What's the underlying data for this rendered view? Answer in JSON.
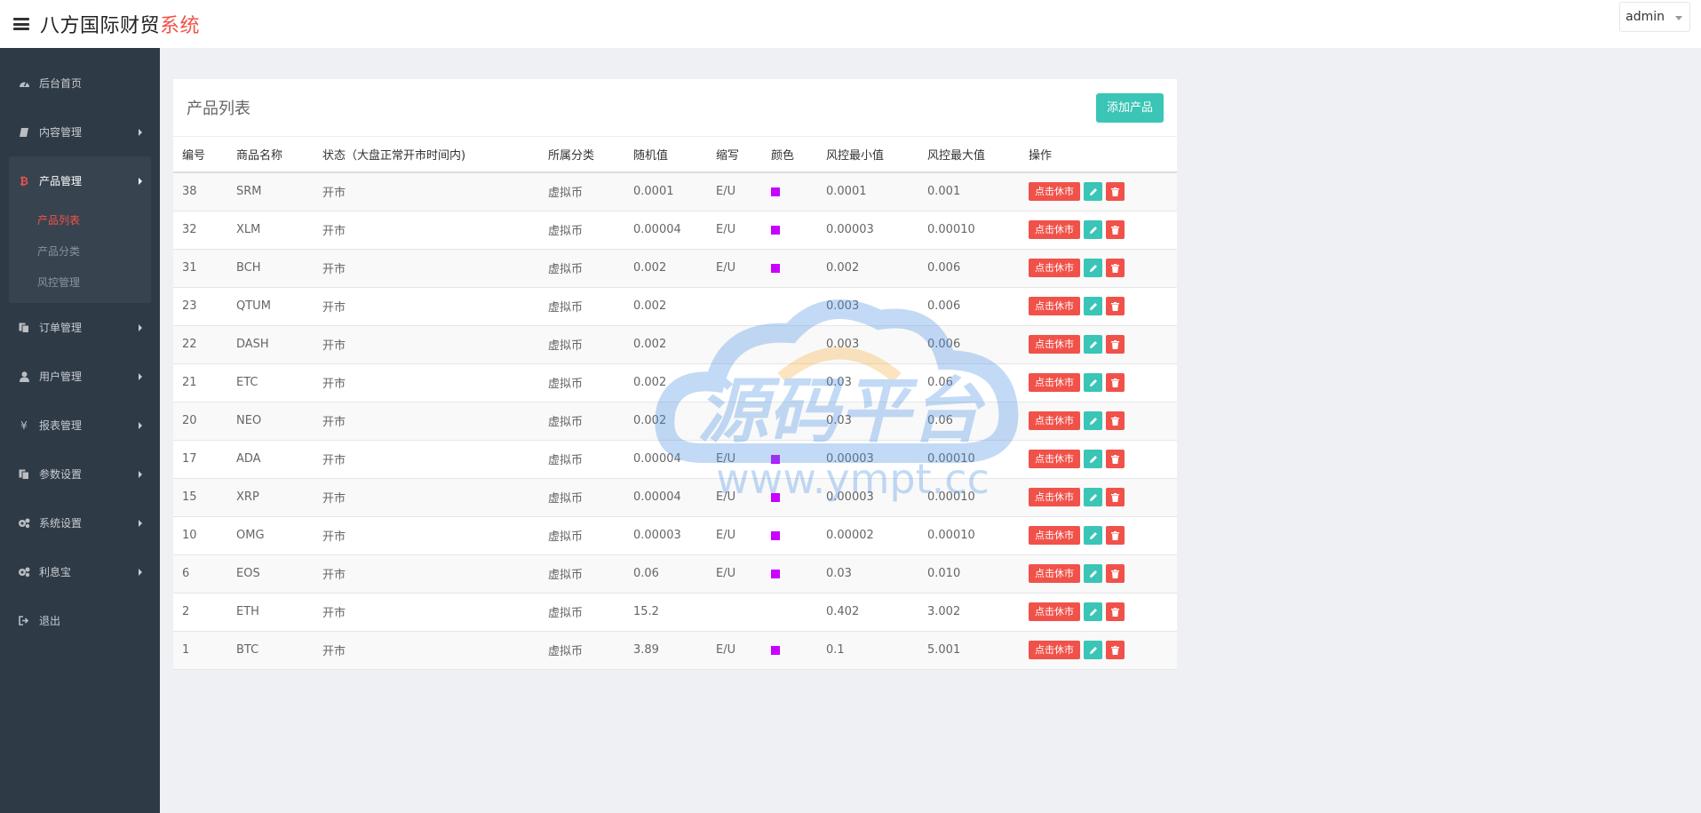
{
  "header": {
    "brand_main": "八方国际财贸",
    "brand_accent": "系统",
    "user": "admin"
  },
  "sidebar": {
    "items": [
      {
        "label": "后台首页",
        "icon": "dashboard-icon"
      },
      {
        "label": "内容管理",
        "icon": "book-icon"
      },
      {
        "label": "产品管理",
        "icon": "bitcoin-icon"
      },
      {
        "label": "订单管理",
        "icon": "copy-icon"
      },
      {
        "label": "用户管理",
        "icon": "user-icon"
      },
      {
        "label": "报表管理",
        "icon": "yen-icon"
      },
      {
        "label": "参数设置",
        "icon": "copy-icon"
      },
      {
        "label": "系统设置",
        "icon": "gears-icon"
      },
      {
        "label": "利息宝",
        "icon": "gears-icon"
      },
      {
        "label": "退出",
        "icon": "sign-out-icon"
      }
    ],
    "submenu": [
      {
        "label": "产品列表",
        "active": true
      },
      {
        "label": "产品分类",
        "active": false
      },
      {
        "label": "风控管理",
        "active": false
      }
    ]
  },
  "panel": {
    "title": "产品列表",
    "add_button": "添加产品"
  },
  "table": {
    "headers": [
      "编号",
      "商品名称",
      "状态（大盘正常开市时间内)",
      "所属分类",
      "随机值",
      "缩写",
      "颜色",
      "风控最小值",
      "风控最大值",
      "操作"
    ],
    "close_label": "点击休市",
    "rows": [
      {
        "id": "38",
        "name": "SRM",
        "status": "开市",
        "category": "虚拟币",
        "random": "0.0001",
        "abbr": "E/U",
        "color": true,
        "min": "0.0001",
        "max": "0.001"
      },
      {
        "id": "32",
        "name": "XLM",
        "status": "开市",
        "category": "虚拟币",
        "random": "0.00004",
        "abbr": "E/U",
        "color": true,
        "min": "0.00003",
        "max": "0.00010"
      },
      {
        "id": "31",
        "name": "BCH",
        "status": "开市",
        "category": "虚拟币",
        "random": "0.002",
        "abbr": "E/U",
        "color": true,
        "min": "0.002",
        "max": "0.006"
      },
      {
        "id": "23",
        "name": "QTUM",
        "status": "开市",
        "category": "虚拟币",
        "random": "0.002",
        "abbr": "",
        "color": false,
        "min": "0.003",
        "max": "0.006"
      },
      {
        "id": "22",
        "name": "DASH",
        "status": "开市",
        "category": "虚拟币",
        "random": "0.002",
        "abbr": "",
        "color": false,
        "min": "0.003",
        "max": "0.006"
      },
      {
        "id": "21",
        "name": "ETC",
        "status": "开市",
        "category": "虚拟币",
        "random": "0.002",
        "abbr": "",
        "color": false,
        "min": "0.03",
        "max": "0.06"
      },
      {
        "id": "20",
        "name": "NEO",
        "status": "开市",
        "category": "虚拟币",
        "random": "0.002",
        "abbr": "",
        "color": false,
        "min": "0.03",
        "max": "0.06"
      },
      {
        "id": "17",
        "name": "ADA",
        "status": "开市",
        "category": "虚拟币",
        "random": "0.00004",
        "abbr": "E/U",
        "color": true,
        "min": "0.00003",
        "max": "0.00010"
      },
      {
        "id": "15",
        "name": "XRP",
        "status": "开市",
        "category": "虚拟币",
        "random": "0.00004",
        "abbr": "E/U",
        "color": true,
        "min": "0.00003",
        "max": "0.00010"
      },
      {
        "id": "10",
        "name": "OMG",
        "status": "开市",
        "category": "虚拟币",
        "random": "0.00003",
        "abbr": "E/U",
        "color": true,
        "min": "0.00002",
        "max": "0.00010"
      },
      {
        "id": "6",
        "name": "EOS",
        "status": "开市",
        "category": "虚拟币",
        "random": "0.06",
        "abbr": "E/U",
        "color": true,
        "min": "0.03",
        "max": "0.010"
      },
      {
        "id": "2",
        "name": "ETH",
        "status": "开市",
        "category": "虚拟币",
        "random": "15.2",
        "abbr": "",
        "color": false,
        "min": "0.402",
        "max": "3.002"
      },
      {
        "id": "1",
        "name": "BTC",
        "status": "开市",
        "category": "虚拟币",
        "random": "3.89",
        "abbr": "E/U",
        "color": true,
        "min": "0.1",
        "max": "5.001"
      }
    ]
  },
  "colors": {
    "accent": "#f0524a",
    "teal": "#3ac5b6",
    "sidebar_bg": "#2e3a46",
    "swatch": "#c800ff"
  },
  "watermark": {
    "title": "源码平台",
    "url": "www.ympt.cc"
  }
}
